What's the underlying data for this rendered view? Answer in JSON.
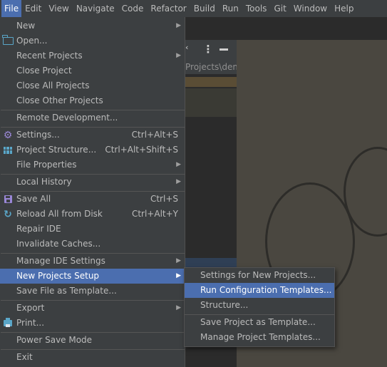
{
  "menubar": {
    "items": [
      "File",
      "Edit",
      "View",
      "Navigate",
      "Code",
      "Refactor",
      "Build",
      "Run",
      "Tools",
      "Git",
      "Window",
      "Help"
    ],
    "active": "File"
  },
  "background": {
    "path_text": "Projects\\dem"
  },
  "file_menu": {
    "items": [
      {
        "label": "New",
        "submenu": true
      },
      {
        "label": "Open...",
        "icon": "folder-icon"
      },
      {
        "label": "Recent Projects",
        "submenu": true
      },
      {
        "label": "Close Project"
      },
      {
        "label": "Close All Projects"
      },
      {
        "label": "Close Other Projects"
      },
      {
        "label": "Remote Development..."
      },
      {
        "label": "Settings...",
        "icon": "gear-icon",
        "shortcut": "Ctrl+Alt+S"
      },
      {
        "label": "Project Structure...",
        "icon": "project-structure-icon",
        "shortcut": "Ctrl+Alt+Shift+S"
      },
      {
        "label": "File Properties",
        "submenu": true
      },
      {
        "label": "Local History",
        "submenu": true
      },
      {
        "label": "Save All",
        "icon": "save-icon",
        "shortcut": "Ctrl+S"
      },
      {
        "label": "Reload All from Disk",
        "icon": "reload-icon",
        "shortcut": "Ctrl+Alt+Y"
      },
      {
        "label": "Repair IDE"
      },
      {
        "label": "Invalidate Caches..."
      },
      {
        "label": "Manage IDE Settings",
        "submenu": true
      },
      {
        "label": "New Projects Setup",
        "submenu": true,
        "highlighted": true
      },
      {
        "label": "Save File as Template..."
      },
      {
        "label": "Export",
        "submenu": true
      },
      {
        "label": "Print...",
        "icon": "print-icon"
      },
      {
        "label": "Power Save Mode"
      },
      {
        "label": "Exit"
      }
    ]
  },
  "new_projects_setup_submenu": {
    "items": [
      {
        "label": "Settings for New Projects..."
      },
      {
        "label": "Run Configuration Templates...",
        "highlighted": true
      },
      {
        "label": "Structure..."
      },
      {
        "label": "Save Project as Template..."
      },
      {
        "label": "Manage Project Templates..."
      }
    ]
  },
  "colors": {
    "menu_bg": "#3c3f41",
    "highlight": "#4b6eaf",
    "text": "#bbbbbb",
    "icon_blue": "#5aa6c8",
    "icon_purple": "#9a87d6"
  }
}
